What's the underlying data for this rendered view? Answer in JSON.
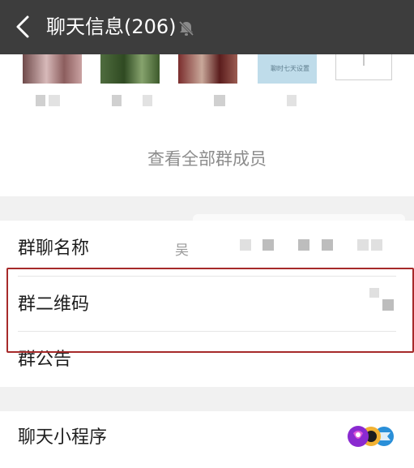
{
  "header": {
    "back_icon": "chevron-left-icon",
    "title": "聊天信息(206)",
    "mute_icon": "bell-muted-icon",
    "background": "#3d3d3d"
  },
  "members": {
    "avatar_caption": "聊时七天设置",
    "add_icon": "plus-icon",
    "view_all": "查看全部群成员"
  },
  "settings": {
    "group_name_label": "群聊名称",
    "group_name_value": "吴",
    "qr_code_label": "群二维码",
    "announcement_label": "群公告",
    "mini_program_label": "聊天小程序",
    "mini_program_icon": "mini-program-apps-icon"
  },
  "highlight_color": "#a62a2a"
}
